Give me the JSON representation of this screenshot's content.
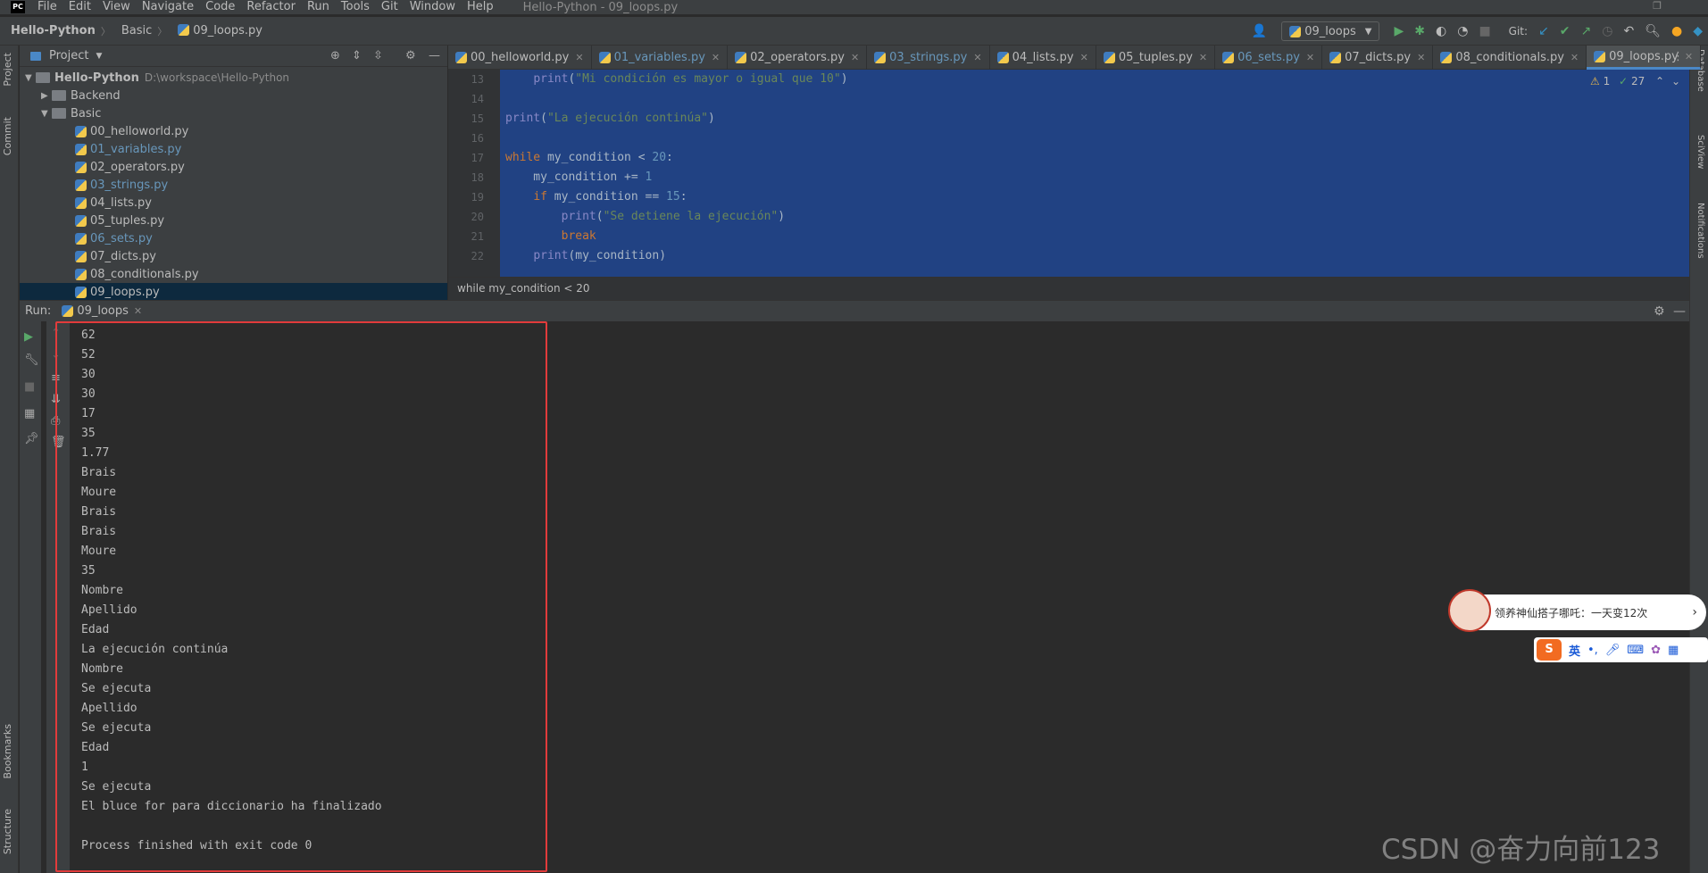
{
  "menubar": {
    "items": [
      "File",
      "Edit",
      "View",
      "Navigate",
      "Code",
      "Refactor",
      "Run",
      "Tools",
      "Git",
      "Window",
      "Help"
    ],
    "window_title": "Hello-Python - 09_loops.py",
    "logo": "PC"
  },
  "navbar": {
    "project": "Hello-Python",
    "folder": "Basic",
    "file": "09_loops.py",
    "run_config": "09_loops",
    "git_label": "Git:"
  },
  "left_stripe": [
    "Project",
    "Commit",
    "Bookmarks",
    "Structure"
  ],
  "right_stripe": [
    "Database",
    "SciView",
    "Notifications"
  ],
  "project_panel": {
    "title": "Project",
    "root": "Hello-Python",
    "root_path": "D:\\workspace\\Hello-Python",
    "items": [
      {
        "label": "Backend",
        "type": "folder"
      },
      {
        "label": "Basic",
        "type": "folder"
      },
      {
        "label": "00_helloworld.py",
        "type": "file"
      },
      {
        "label": "01_variables.py",
        "type": "file-modified"
      },
      {
        "label": "02_operators.py",
        "type": "file"
      },
      {
        "label": "03_strings.py",
        "type": "file-modified"
      },
      {
        "label": "04_lists.py",
        "type": "file"
      },
      {
        "label": "05_tuples.py",
        "type": "file"
      },
      {
        "label": "06_sets.py",
        "type": "file-modified"
      },
      {
        "label": "07_dicts.py",
        "type": "file"
      },
      {
        "label": "08_conditionals.py",
        "type": "file"
      },
      {
        "label": "09_loops.py",
        "type": "file-selected"
      }
    ]
  },
  "editor_tabs": [
    {
      "label": "00_helloworld.py",
      "modified": false
    },
    {
      "label": "01_variables.py",
      "modified": true
    },
    {
      "label": "02_operators.py",
      "modified": false
    },
    {
      "label": "03_strings.py",
      "modified": true
    },
    {
      "label": "04_lists.py",
      "modified": false
    },
    {
      "label": "05_tuples.py",
      "modified": false
    },
    {
      "label": "06_sets.py",
      "modified": true
    },
    {
      "label": "07_dicts.py",
      "modified": false
    },
    {
      "label": "08_conditionals.py",
      "modified": false
    },
    {
      "label": "09_loops.py",
      "modified": false,
      "active": true
    }
  ],
  "inspection": {
    "warnings": "1",
    "checks": "27"
  },
  "code_lines": [
    {
      "n": "13",
      "html": "    <span class='fn'>print</span>(<span class='str'>\"Mi condición es mayor o igual que 10\"</span>)"
    },
    {
      "n": "14",
      "html": ""
    },
    {
      "n": "15",
      "html": "<span class='fn'>print</span>(<span class='str'>\"La ejecución continúa\"</span>)"
    },
    {
      "n": "16",
      "html": ""
    },
    {
      "n": "17",
      "html": "<span class='kw'>while</span> my_condition &lt; <span class='num'>20</span>:"
    },
    {
      "n": "18",
      "html": "    my_condition += <span class='num'>1</span>"
    },
    {
      "n": "19",
      "html": "    <span class='kw'>if</span> my_condition == <span class='num'>15</span>:"
    },
    {
      "n": "20",
      "html": "        <span class='fn'>print</span>(<span class='str'>\"Se detiene la ejecución\"</span>)"
    },
    {
      "n": "21",
      "html": "        <span class='kw'>break</span>"
    },
    {
      "n": "22",
      "html": "    <span class='fn'>print</span>(my_condition)"
    }
  ],
  "breadcrumb_line": "while my_condition < 20",
  "run_panel": {
    "label": "Run:",
    "tab": "09_loops"
  },
  "console_lines": [
    "62",
    "52",
    "30",
    "30",
    "17",
    "35",
    "1.77",
    "Brais",
    "Moure",
    "Brais",
    "Brais",
    "Moure",
    "35",
    "Nombre",
    "Apellido",
    "Edad",
    "La ejecución continúa",
    "Nombre",
    "Se ejecuta",
    "Apellido",
    "Se ejecuta",
    "Edad",
    "1",
    "Se ejecuta",
    "El bluce for para diccionario ha finalizado",
    "",
    "Process finished with exit code 0"
  ],
  "ad_popup": {
    "text": "领养神仙搭子哪吒：一天变12次"
  },
  "ime": {
    "mode": "英"
  },
  "watermark": "CSDN @奋力向前123"
}
